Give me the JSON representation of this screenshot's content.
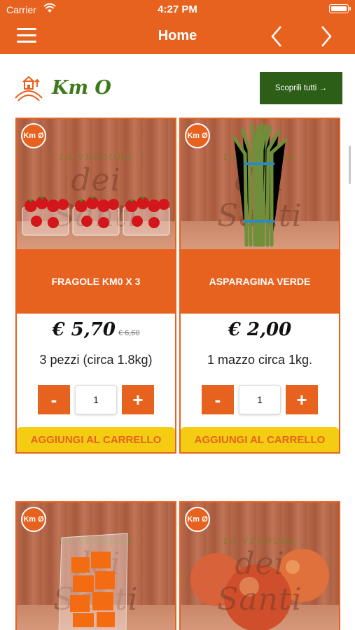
{
  "status_bar": {
    "carrier": "Carrier",
    "time": "4:27 PM"
  },
  "nav": {
    "title": "Home",
    "menu_icon": "hamburger-icon",
    "prev_icon": "chevron-left-icon",
    "next_icon": "chevron-right-icon"
  },
  "section": {
    "title": "Km O",
    "discover_label": "Scoprili tutti →",
    "icon": "farm-icon"
  },
  "brand_watermark": {
    "top": "LA VERDURA",
    "main": "dei Santi"
  },
  "badge_label": "Km Ø",
  "products": [
    {
      "name": "FRAGOLE KM0 X 3",
      "price": "€ 5,70",
      "old_price": "€ 6,60",
      "description": "3 pezzi (circa 1.8kg)",
      "quantity": "1",
      "add_label": "AGGIUNGI AL CARRELLO"
    },
    {
      "name": "ASPARAGINA VERDE",
      "price": "€ 2,00",
      "old_price": "",
      "description": "1 mazzo circa 1kg.",
      "quantity": "1",
      "add_label": "AGGIUNGI AL CARRELLO"
    }
  ],
  "qty_controls": {
    "minus": "-",
    "plus": "+"
  },
  "colors": {
    "primary": "#e8621f",
    "green": "#2d5e18",
    "yellow": "#f4cc11"
  }
}
